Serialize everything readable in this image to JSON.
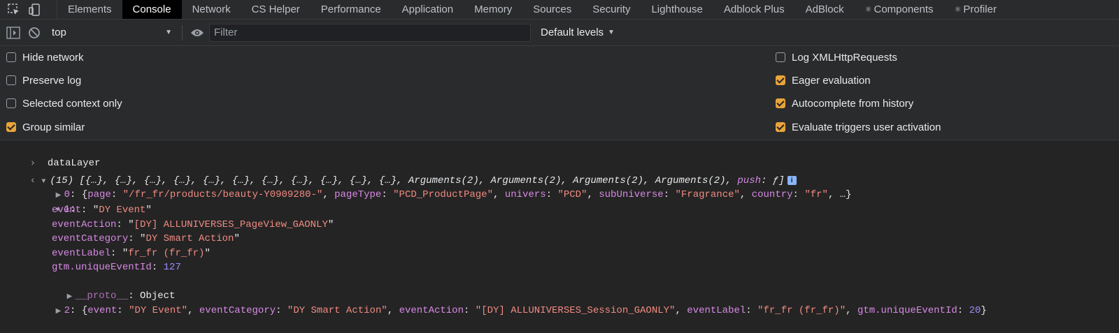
{
  "tabs": [
    {
      "label": "Elements"
    },
    {
      "label": "Console",
      "active": true
    },
    {
      "label": "Network"
    },
    {
      "label": "CS Helper"
    },
    {
      "label": "Performance"
    },
    {
      "label": "Application"
    },
    {
      "label": "Memory"
    },
    {
      "label": "Sources"
    },
    {
      "label": "Security"
    },
    {
      "label": "Lighthouse"
    },
    {
      "label": "Adblock Plus"
    },
    {
      "label": "AdBlock"
    },
    {
      "label": "Components",
      "glyph": "⚛"
    },
    {
      "label": "Profiler",
      "glyph": "⚛"
    }
  ],
  "toolbar": {
    "context": "top",
    "filter_placeholder": "Filter",
    "levels": "Default levels"
  },
  "settings": {
    "left": [
      {
        "label": "Hide network",
        "checked": false
      },
      {
        "label": "Preserve log",
        "checked": false
      },
      {
        "label": "Selected context only",
        "checked": false
      },
      {
        "label": "Group similar",
        "checked": true
      }
    ],
    "right": [
      {
        "label": "Log XMLHttpRequests",
        "checked": false
      },
      {
        "label": "Eager evaluation",
        "checked": true
      },
      {
        "label": "Autocomplete from history",
        "checked": true
      },
      {
        "label": "Evaluate triggers user activation",
        "checked": true
      }
    ]
  },
  "console": {
    "input": "dataLayer",
    "result_summary": "(15) [{…}, {…}, {…}, {…}, {…}, {…}, {…}, {…}, {…}, {…}, {…}, Arguments(2), Arguments(2), Arguments(2), Arguments(2), ",
    "result_push": "push",
    "result_push_tail": ": ƒ]",
    "info_badge": "i",
    "item0": {
      "index": "0",
      "segments": [
        {
          "t": "p",
          "v": ": {"
        },
        {
          "t": "k",
          "v": "page"
        },
        {
          "t": "p",
          "v": ": "
        },
        {
          "t": "s",
          "v": "\"/fr_fr/products/beauty-Y0909280-\""
        },
        {
          "t": "p",
          "v": ", "
        },
        {
          "t": "k",
          "v": "pageType"
        },
        {
          "t": "p",
          "v": ": "
        },
        {
          "t": "s",
          "v": "\"PCD_ProductPage\""
        },
        {
          "t": "p",
          "v": ", "
        },
        {
          "t": "k",
          "v": "univers"
        },
        {
          "t": "p",
          "v": ": "
        },
        {
          "t": "s",
          "v": "\"PCD\""
        },
        {
          "t": "p",
          "v": ", "
        },
        {
          "t": "k",
          "v": "subUniverse"
        },
        {
          "t": "p",
          "v": ": "
        },
        {
          "t": "s",
          "v": "\"Fragrance\""
        },
        {
          "t": "p",
          "v": ", "
        },
        {
          "t": "k",
          "v": "country"
        },
        {
          "t": "p",
          "v": ": "
        },
        {
          "t": "s",
          "v": "\"fr\""
        },
        {
          "t": "p",
          "v": ", …}"
        }
      ]
    },
    "item1": {
      "index": "1",
      "props": [
        {
          "key": "event",
          "value": "DY Event",
          "type": "string"
        },
        {
          "key": "eventAction",
          "value": "[DY] ALLUNIVERSES_PageView_GAONLY",
          "type": "string"
        },
        {
          "key": "eventCategory",
          "value": "DY Smart Action",
          "type": "string"
        },
        {
          "key": "eventLabel",
          "value": "fr_fr (fr_fr)",
          "type": "string"
        },
        {
          "key": "gtm.uniqueEventId",
          "value": "127",
          "type": "number"
        }
      ],
      "proto_key": "__proto__",
      "proto_value": "Object"
    },
    "item2": {
      "index": "2",
      "segments": [
        {
          "t": "p",
          "v": ": {"
        },
        {
          "t": "k",
          "v": "event"
        },
        {
          "t": "p",
          "v": ": "
        },
        {
          "t": "s",
          "v": "\"DY Event\""
        },
        {
          "t": "p",
          "v": ", "
        },
        {
          "t": "k",
          "v": "eventCategory"
        },
        {
          "t": "p",
          "v": ": "
        },
        {
          "t": "s",
          "v": "\"DY Smart Action\""
        },
        {
          "t": "p",
          "v": ", "
        },
        {
          "t": "k",
          "v": "eventAction"
        },
        {
          "t": "p",
          "v": ": "
        },
        {
          "t": "s",
          "v": "\"[DY] ALLUNIVERSES_Session_GAONLY\""
        },
        {
          "t": "p",
          "v": ", "
        },
        {
          "t": "k",
          "v": "eventLabel"
        },
        {
          "t": "p",
          "v": ": "
        },
        {
          "t": "s",
          "v": "\"fr_fr (fr_fr)\""
        },
        {
          "t": "p",
          "v": ", "
        },
        {
          "t": "k",
          "v": "gtm.uniqueEventId"
        },
        {
          "t": "p",
          "v": ": "
        },
        {
          "t": "n",
          "v": "20"
        },
        {
          "t": "p",
          "v": "}"
        }
      ]
    }
  },
  "colors": {
    "background": "#242424",
    "toolbar": "#2a2b2d",
    "checkbox_checked": "#e8a43a",
    "key": "#d88ae6",
    "string": "#f28b82",
    "number": "#9d8cff"
  }
}
